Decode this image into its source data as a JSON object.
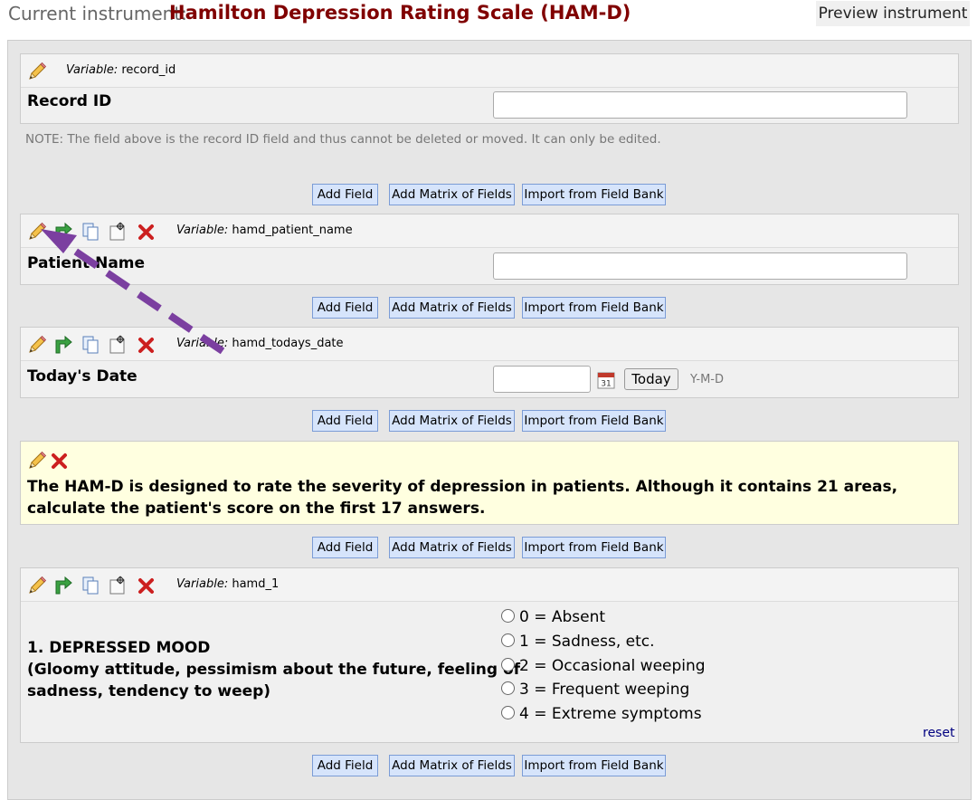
{
  "header": {
    "current_label": "Current instrument:",
    "instrument_name": "Hamilton Depression Rating Scale (HAM-D)",
    "preview_button": "Preview instrument"
  },
  "add_buttons": {
    "add_field": "Add Field",
    "add_matrix": "Add Matrix of Fields",
    "import_bank": "Import from Field Bank"
  },
  "variable_prefix": "Variable:",
  "fields": {
    "record_id": {
      "variable": "record_id",
      "label": "Record ID"
    },
    "patient_name": {
      "variable": "hamd_patient_name",
      "label": "Patient Name"
    },
    "todays_date": {
      "variable": "hamd_todays_date",
      "label": "Today's Date",
      "today_button": "Today",
      "format": "Y-M-D"
    },
    "hamd_1": {
      "variable": "hamd_1",
      "label_line1": "1. DEPRESSED MOOD",
      "label_line2": "(Gloomy attitude, pessimism about the future, feeling of",
      "label_line3": "sadness, tendency to weep)",
      "options": [
        "0 = Absent",
        "1 = Sadness, etc.",
        "2 = Occasional weeping",
        "3 = Frequent weeping",
        "4 = Extreme symptoms"
      ],
      "reset": "reset"
    }
  },
  "note": "NOTE: The field above is the record ID field and thus cannot be deleted or moved. It can only be edited.",
  "description": "The HAM-D is designed to rate the severity of depression in patients. Although it contains 21 areas, calculate the patient's score on the first 17 answers.",
  "colors": {
    "title": "#800000",
    "button_bg": "#d6e4fb",
    "button_border": "#7b9cd6",
    "description_bg": "#ffffe0",
    "arrow": "#7b3fa0"
  },
  "icons": [
    "pencil-icon",
    "branch-arrow-icon",
    "copy-icon",
    "move-icon",
    "delete-icon",
    "calendar-icon"
  ]
}
